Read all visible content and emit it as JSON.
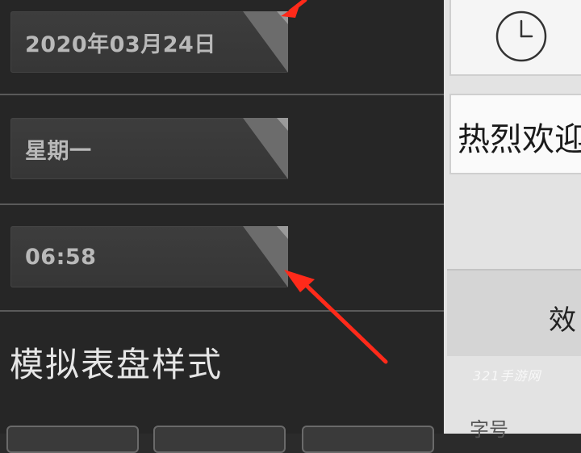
{
  "fields": {
    "date_value": "2020年03月24日",
    "weekday_value": "星期一",
    "time_value": "06:58"
  },
  "section": {
    "title": "模拟表盘样式"
  },
  "preview": {
    "icon": "clock-icon",
    "welcome_text": "热烈欢迎",
    "effect_label": "效",
    "font_size_label": "字号"
  },
  "watermark": {
    "text": "321手游网"
  },
  "colors": {
    "panel_dark": "#262626",
    "field_bg": "#3d3d3d",
    "field_text": "#b9b9b9",
    "annotation_arrow": "#ff2a1a",
    "preview_bg": "#e3e3e3"
  }
}
